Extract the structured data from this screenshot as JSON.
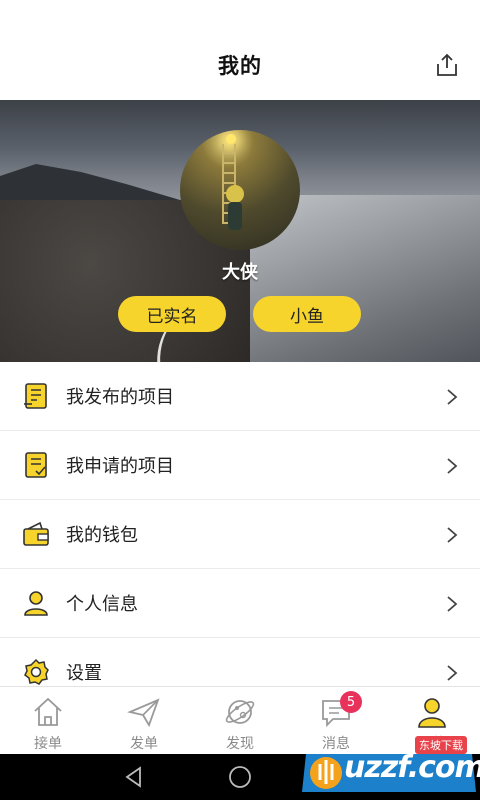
{
  "header": {
    "title": "我的"
  },
  "profile": {
    "username": "大侠",
    "tags": [
      "已实名",
      "小鱼"
    ]
  },
  "menu": {
    "items": [
      {
        "label": "我发布的项目",
        "icon": "published-project-icon"
      },
      {
        "label": "我申请的项目",
        "icon": "applied-project-icon"
      },
      {
        "label": "我的钱包",
        "icon": "wallet-icon"
      },
      {
        "label": "个人信息",
        "icon": "user-icon"
      },
      {
        "label": "设置",
        "icon": "gear-icon"
      }
    ]
  },
  "tabbar": {
    "tabs": [
      {
        "label": "接单",
        "icon": "home-icon"
      },
      {
        "label": "发单",
        "icon": "paper-plane-icon"
      },
      {
        "label": "发现",
        "icon": "planet-icon"
      },
      {
        "label": "消息",
        "icon": "message-icon",
        "badge": "5"
      },
      {
        "label": "我的",
        "icon": "person-icon",
        "active": true
      }
    ]
  },
  "watermark": {
    "brand": "uzzf.com",
    "tagline": "东坡下载"
  },
  "colors": {
    "accent": "#f7d42c",
    "badge": "#e8315b"
  }
}
